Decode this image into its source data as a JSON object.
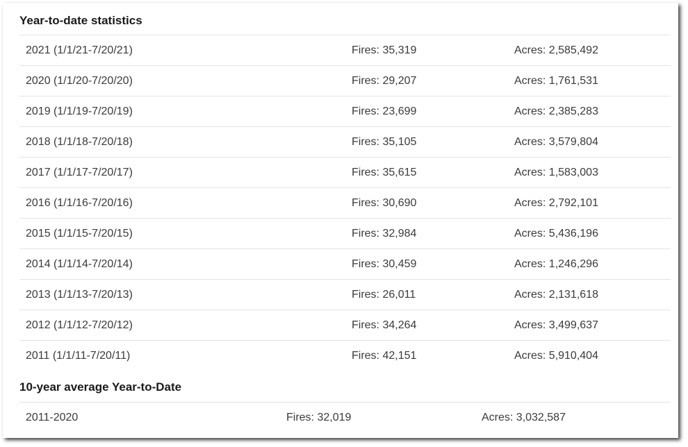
{
  "ytd": {
    "title": "Year-to-date statistics",
    "rows": [
      {
        "period": "2021 (1/1/21-7/20/21)",
        "fires": "Fires: 35,319",
        "acres": "Acres: 2,585,492"
      },
      {
        "period": "2020 (1/1/20-7/20/20)",
        "fires": "Fires: 29,207",
        "acres": "Acres: 1,761,531"
      },
      {
        "period": "2019 (1/1/19-7/20/19)",
        "fires": "Fires: 23,699",
        "acres": "Acres: 2,385,283"
      },
      {
        "period": "2018 (1/1/18-7/20/18)",
        "fires": "Fires: 35,105",
        "acres": "Acres: 3,579,804"
      },
      {
        "period": "2017 (1/1/17-7/20/17)",
        "fires": "Fires: 35,615",
        "acres": "Acres: 1,583,003"
      },
      {
        "period": "2016 (1/1/16-7/20/16)",
        "fires": "Fires: 30,690",
        "acres": "Acres: 2,792,101"
      },
      {
        "period": "2015 (1/1/15-7/20/15)",
        "fires": "Fires: 32,984",
        "acres": "Acres: 5,436,196"
      },
      {
        "period": "2014 (1/1/14-7/20/14)",
        "fires": "Fires: 30,459",
        "acres": "Acres: 1,246,296"
      },
      {
        "period": "2013 (1/1/13-7/20/13)",
        "fires": "Fires: 26,011",
        "acres": "Acres: 2,131,618"
      },
      {
        "period": "2012 (1/1/12-7/20/12)",
        "fires": "Fires: 34,264",
        "acres": "Acres: 3,499,637"
      },
      {
        "period": "2011 (1/1/11-7/20/11)",
        "fires": "Fires: 42,151",
        "acres": "Acres: 5,910,404"
      }
    ]
  },
  "average": {
    "title": "10-year average Year-to-Date",
    "rows": [
      {
        "period": "2011-2020",
        "fires": "Fires: 32,019",
        "acres": "Acres: 3,032,587"
      }
    ]
  }
}
